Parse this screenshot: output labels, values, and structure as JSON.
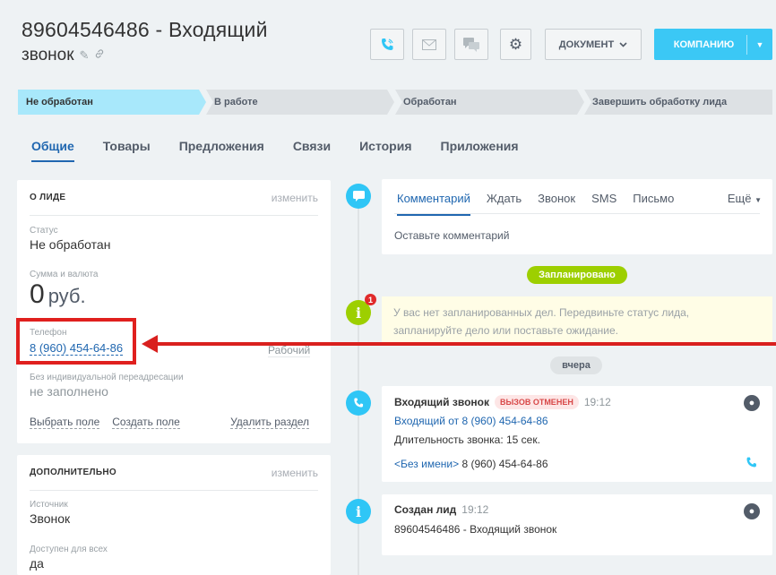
{
  "header": {
    "title_line1": "89604546486 - Входящий",
    "title_line2": "звонок",
    "edit_icon": "pencil-icon",
    "link_icon": "link-icon"
  },
  "toolbar": {
    "call_icon": "phone-icon",
    "mail_icon": "envelope-icon",
    "chat_icon": "chat-icon",
    "settings_icon": "gear-icon",
    "document_label": "ДОКУМЕНТ",
    "company_label": "КОМПАНИЮ"
  },
  "stages": [
    {
      "label": "Не обработан"
    },
    {
      "label": "В работе"
    },
    {
      "label": "Обработан"
    },
    {
      "label": "Завершить обработку лида"
    }
  ],
  "tabs": [
    {
      "label": "Общие"
    },
    {
      "label": "Товары"
    },
    {
      "label": "Предложения"
    },
    {
      "label": "Связи"
    },
    {
      "label": "История"
    },
    {
      "label": "Приложения"
    }
  ],
  "lead_card": {
    "title": "О ЛИДЕ",
    "edit": "изменить",
    "status_label": "Статус",
    "status_value": "Не обработан",
    "sum_label": "Сумма и валюта",
    "sum_value": "0",
    "sum_currency": "руб.",
    "phone_label": "Телефон",
    "phone_value": "8 (960) 454-64-86",
    "phone_type": "Рабочий",
    "forward_label": "Без индивидуальной переадресации",
    "forward_value": "не заполнено",
    "select_field": "Выбрать поле",
    "create_field": "Создать поле",
    "delete_section": "Удалить раздел"
  },
  "extra_card": {
    "title": "ДОПОЛНИТЕЛЬНО",
    "edit": "изменить",
    "source_label": "Источник",
    "source_value": "Звонок",
    "available_label": "Доступен для всех",
    "available_value": "да"
  },
  "activity": {
    "tabs": [
      "Комментарий",
      "Ждать",
      "Звонок",
      "SMS",
      "Письмо"
    ],
    "more": "Ещё",
    "placeholder": "Оставьте комментарий"
  },
  "timeline": {
    "planned_label": "Запланировано",
    "alert_count": "1",
    "empty_line1": "У вас нет запланированных дел. Передвиньте статус лида,",
    "empty_line2": "запланируйте дело или поставьте ожидание.",
    "yesterday_label": "вчера",
    "call_event": {
      "title": "Входящий звонок",
      "badge": "ВЫЗОВ ОТМЕНЕН",
      "time": "19:12",
      "link": "Входящий от 8 (960) 454-64-86",
      "duration": "Длительность звонка: 15 сек.",
      "contact_name": "<Без имени>",
      "contact_phone": "8 (960) 454-64-86"
    },
    "created_event": {
      "title": "Создан лид",
      "time": "19:12",
      "text": "89604546486 - Входящий звонок"
    }
  },
  "colors": {
    "accent": "#3bc8f5",
    "link": "#2067b0",
    "active_stage": "#a8e8fb",
    "planned": "#9dcf00",
    "highlight": "#e0201e"
  }
}
